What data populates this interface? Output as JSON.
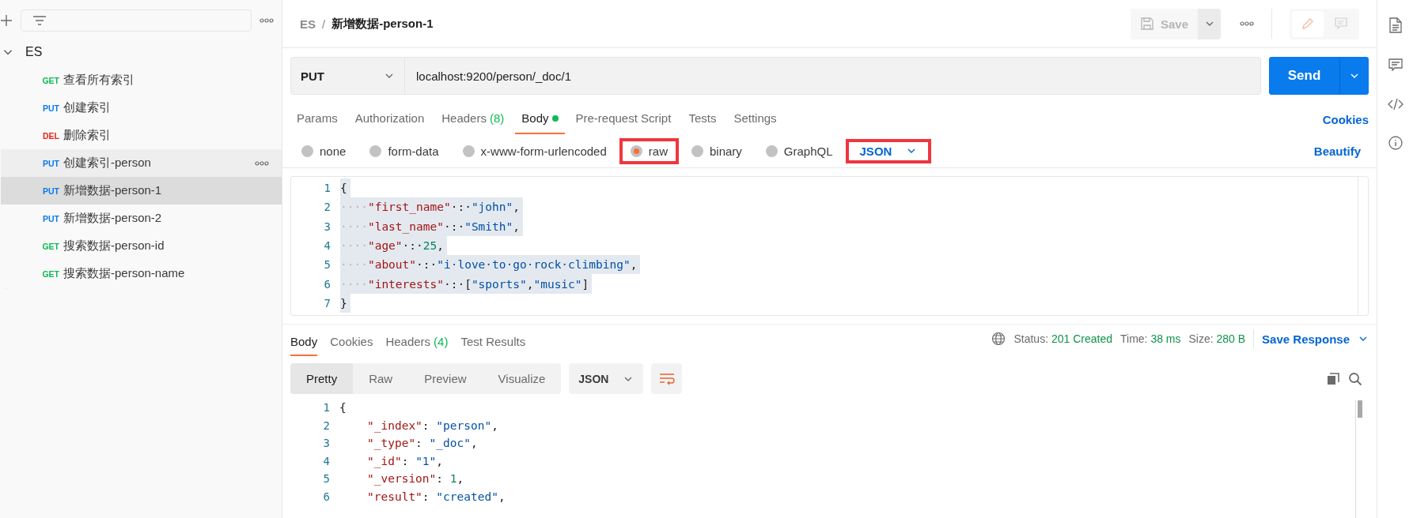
{
  "sidebar": {
    "collection": {
      "name": "ES",
      "expanded": true,
      "items": [
        {
          "method": "GET",
          "name": "查看所有索引",
          "selected": false,
          "hovered": false
        },
        {
          "method": "PUT",
          "name": "创建索引",
          "selected": false,
          "hovered": false
        },
        {
          "method": "DEL",
          "name": "删除索引",
          "selected": false,
          "hovered": false
        },
        {
          "method": "PUT",
          "name": "创建索引-person",
          "selected": false,
          "hovered": true
        },
        {
          "method": "PUT",
          "name": "新增数据-person-1",
          "selected": true,
          "hovered": false
        },
        {
          "method": "PUT",
          "name": "新增数据-person-2",
          "selected": false,
          "hovered": false
        },
        {
          "method": "GET",
          "name": "搜索数据-person-id",
          "selected": false,
          "hovered": false
        },
        {
          "method": "GET",
          "name": "搜索数据-person-name",
          "selected": false,
          "hovered": false
        }
      ]
    }
  },
  "header": {
    "breadcrumb": {
      "parent": "ES",
      "separator": "/",
      "title": "新增数据-person-1"
    },
    "save_label": "Save"
  },
  "request": {
    "method": "PUT",
    "url": "localhost:9200/person/_doc/1",
    "send_label": "Send",
    "tabs": [
      {
        "label": "Params",
        "selected": false
      },
      {
        "label": "Authorization",
        "selected": false
      },
      {
        "label": "Headers",
        "count": "(8)",
        "selected": false
      },
      {
        "label": "Body",
        "dot": true,
        "selected": true
      },
      {
        "label": "Pre-request Script",
        "selected": false
      },
      {
        "label": "Tests",
        "selected": false
      },
      {
        "label": "Settings",
        "selected": false
      }
    ],
    "cookies_link": "Cookies",
    "body_types": [
      {
        "label": "none",
        "selected": false,
        "highlighted": false
      },
      {
        "label": "form-data",
        "selected": false,
        "highlighted": false
      },
      {
        "label": "x-www-form-urlencoded",
        "selected": false,
        "highlighted": false
      },
      {
        "label": "raw",
        "selected": true,
        "highlighted": true
      },
      {
        "label": "binary",
        "selected": false,
        "highlighted": false
      },
      {
        "label": "GraphQL",
        "selected": false,
        "highlighted": false
      }
    ],
    "body_language": {
      "value": "JSON",
      "highlighted": true
    },
    "beautify_link": "Beautify",
    "body_lines": [
      {
        "number": "1",
        "tokens": [
          {
            "kind": "punct",
            "text": "{"
          }
        ]
      },
      {
        "number": "2",
        "tokens": [
          {
            "kind": "ws",
            "text": "····"
          },
          {
            "kind": "key",
            "text": "\"first_name\""
          },
          {
            "kind": "punct",
            "text": "·:·"
          },
          {
            "kind": "string",
            "text": "\"john\""
          },
          {
            "kind": "punct",
            "text": ","
          }
        ]
      },
      {
        "number": "3",
        "tokens": [
          {
            "kind": "ws",
            "text": "····"
          },
          {
            "kind": "key",
            "text": "\"last_name\""
          },
          {
            "kind": "punct",
            "text": "·:·"
          },
          {
            "kind": "string",
            "text": "\"Smith\""
          },
          {
            "kind": "punct",
            "text": ","
          }
        ]
      },
      {
        "number": "4",
        "tokens": [
          {
            "kind": "ws",
            "text": "····"
          },
          {
            "kind": "key",
            "text": "\"age\""
          },
          {
            "kind": "punct",
            "text": "·:·"
          },
          {
            "kind": "number",
            "text": "25"
          },
          {
            "kind": "punct",
            "text": ","
          }
        ]
      },
      {
        "number": "5",
        "tokens": [
          {
            "kind": "ws",
            "text": "····"
          },
          {
            "kind": "key",
            "text": "\"about\""
          },
          {
            "kind": "punct",
            "text": "·:·"
          },
          {
            "kind": "string",
            "text": "\"i·love·to·go·rock·climbing\""
          },
          {
            "kind": "punct",
            "text": ","
          }
        ]
      },
      {
        "number": "6",
        "tokens": [
          {
            "kind": "ws",
            "text": "····"
          },
          {
            "kind": "key",
            "text": "\"interests\""
          },
          {
            "kind": "punct",
            "text": "·:·["
          },
          {
            "kind": "string",
            "text": "\"sports\""
          },
          {
            "kind": "punct",
            "text": ","
          },
          {
            "kind": "string",
            "text": "\"music\""
          },
          {
            "kind": "punct",
            "text": "]"
          }
        ]
      },
      {
        "number": "7",
        "tokens": [
          {
            "kind": "punct",
            "text": "}"
          }
        ]
      }
    ]
  },
  "response": {
    "tabs": [
      {
        "label": "Body",
        "selected": true
      },
      {
        "label": "Cookies",
        "selected": false
      },
      {
        "label": "Headers",
        "count": "(4)",
        "selected": false
      },
      {
        "label": "Test Results",
        "selected": false
      }
    ],
    "stats": [
      {
        "label": "Status:",
        "value": "201 Created"
      },
      {
        "label": "Time:",
        "value": "38 ms"
      },
      {
        "label": "Size:",
        "value": "280 B"
      }
    ],
    "save_response": "Save Response",
    "views": [
      {
        "label": "Pretty",
        "selected": true
      },
      {
        "label": "Raw",
        "selected": false
      },
      {
        "label": "Preview",
        "selected": false
      },
      {
        "label": "Visualize",
        "selected": false
      }
    ],
    "format": "JSON",
    "lines": [
      {
        "number": "1",
        "tokens": [
          {
            "kind": "punct",
            "text": "{"
          }
        ]
      },
      {
        "number": "2",
        "indented": true,
        "tokens": [
          {
            "kind": "key",
            "text": "\"_index\""
          },
          {
            "kind": "punct",
            "text": ": "
          },
          {
            "kind": "string",
            "text": "\"person\""
          },
          {
            "kind": "punct",
            "text": ","
          }
        ]
      },
      {
        "number": "3",
        "indented": true,
        "tokens": [
          {
            "kind": "key",
            "text": "\"_type\""
          },
          {
            "kind": "punct",
            "text": ": "
          },
          {
            "kind": "string",
            "text": "\"_doc\""
          },
          {
            "kind": "punct",
            "text": ","
          }
        ]
      },
      {
        "number": "4",
        "indented": true,
        "tokens": [
          {
            "kind": "key",
            "text": "\"_id\""
          },
          {
            "kind": "punct",
            "text": ": "
          },
          {
            "kind": "string",
            "text": "\"1\""
          },
          {
            "kind": "punct",
            "text": ","
          }
        ]
      },
      {
        "number": "5",
        "indented": true,
        "tokens": [
          {
            "kind": "key",
            "text": "\"_version\""
          },
          {
            "kind": "punct",
            "text": ": "
          },
          {
            "kind": "number",
            "text": "1"
          },
          {
            "kind": "punct",
            "text": ","
          }
        ]
      },
      {
        "number": "6",
        "indented": true,
        "tokens": [
          {
            "kind": "key",
            "text": "\"result\""
          },
          {
            "kind": "punct",
            "text": ": "
          },
          {
            "kind": "string",
            "text": "\"created\""
          },
          {
            "kind": "punct",
            "text": ","
          }
        ]
      }
    ]
  }
}
